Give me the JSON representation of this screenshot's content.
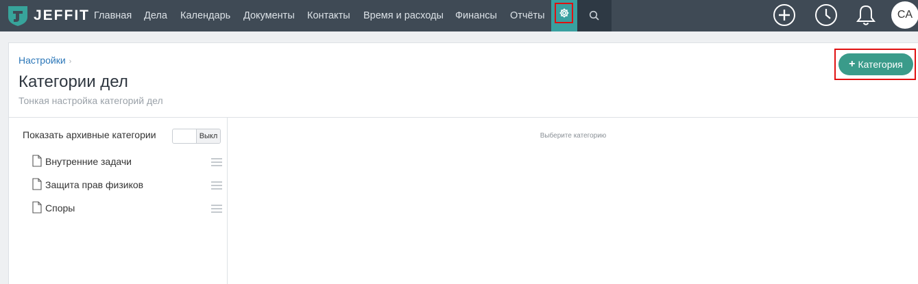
{
  "app": {
    "name": "JEFFIT"
  },
  "nav": {
    "items": [
      "Главная",
      "Дела",
      "Календарь",
      "Документы",
      "Контакты",
      "Время и расходы",
      "Финансы",
      "Отчёты"
    ],
    "settings_icon": "gear-icon",
    "search_icon": "search-icon",
    "right_icons": [
      "plus-circle-icon",
      "clock-icon",
      "bell-icon"
    ],
    "avatar_initials": "CA"
  },
  "colors": {
    "navbar": "#3f4a55",
    "accent": "#39a0a0",
    "button": "#3a9b8a",
    "link": "#2a76b8",
    "highlight": "#e01010"
  },
  "breadcrumb": {
    "parent": "Настройки",
    "separator": "›"
  },
  "header": {
    "title": "Категории дел",
    "subtitle": "Тонкая настройка категорий дел",
    "add_button": {
      "icon": "+",
      "label": "Категория"
    }
  },
  "sidebar": {
    "show_archived_label": "Показать архивные категории",
    "toggle_state": "Выкл",
    "categories": [
      {
        "label": "Внутренние задачи",
        "icon": "file-icon"
      },
      {
        "label": "Защита прав физиков",
        "icon": "file-icon"
      },
      {
        "label": "Споры",
        "icon": "file-icon"
      }
    ]
  },
  "main": {
    "empty_hint": "Выберите категорию"
  }
}
